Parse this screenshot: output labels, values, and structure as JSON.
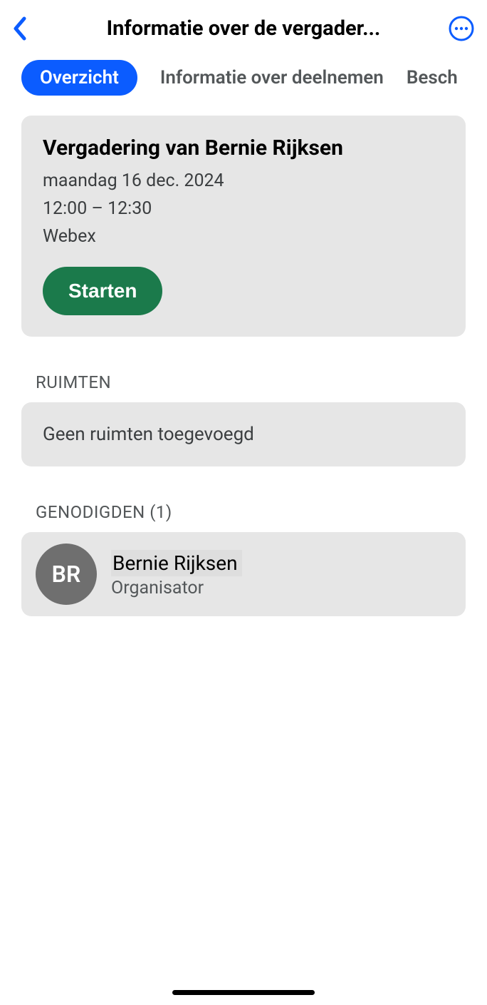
{
  "header": {
    "title": "Informatie over de vergader..."
  },
  "tabs": {
    "overview": "Overzicht",
    "join_info": "Informatie over deelnemen",
    "description": "Besch"
  },
  "meeting": {
    "title": "Vergadering van Bernie Rijksen",
    "date": "maandag 16 dec. 2024",
    "time": "12:00 – 12:30",
    "platform": "Webex",
    "start_label": "Starten"
  },
  "rooms": {
    "label": "RUIMTEN",
    "empty": "Geen ruimten toegevoegd"
  },
  "invitees": {
    "label": "GENODIGDEN (1)",
    "list": [
      {
        "initials": "BR",
        "name": "Bernie Rijksen",
        "role": "Organisator"
      }
    ]
  }
}
